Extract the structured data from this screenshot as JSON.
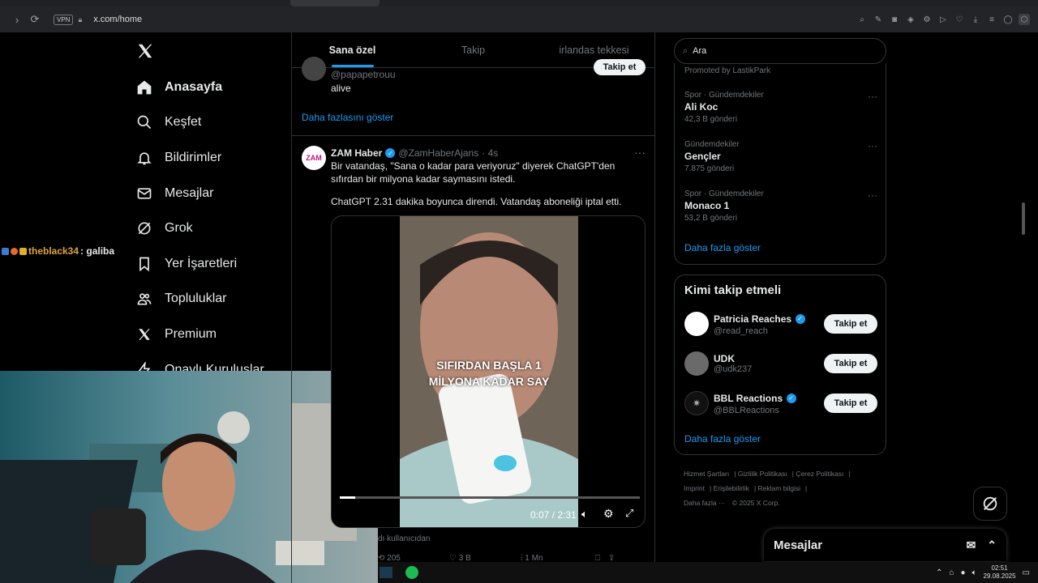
{
  "browser": {
    "url": "x.com/home",
    "vpn_label": "VPN"
  },
  "nav": {
    "items": [
      {
        "label": "Anasayfa",
        "icon": "home-icon"
      },
      {
        "label": "Keşfet",
        "icon": "search-icon"
      },
      {
        "label": "Bildirimler",
        "icon": "bell-icon"
      },
      {
        "label": "Mesajlar",
        "icon": "mail-icon"
      },
      {
        "label": "Grok",
        "icon": "grok-icon"
      },
      {
        "label": "Yer İşaretleri",
        "icon": "bookmark-icon"
      },
      {
        "label": "Topluluklar",
        "icon": "people-icon"
      },
      {
        "label": "Premium",
        "icon": "x-logo-icon"
      },
      {
        "label": "Onaylı Kuruluşlar",
        "icon": "lightning-icon"
      }
    ]
  },
  "chat": {
    "user": "theblack34",
    "message": ": galiba"
  },
  "timeline": {
    "tabs": [
      "Sana özel",
      "Takip",
      "irlandas tekkesi"
    ],
    "prev_tweet": {
      "handle": "@papapetrouu",
      "text": "alive",
      "follow_label": "Takip et"
    },
    "show_more": "Daha fazlasını göster",
    "tweet": {
      "name": "ZAM Haber",
      "avatar_text": "ZAM",
      "handle": "@ZamHaberAjans",
      "time": "· 4s",
      "text1": "Bir vatandaş, \"Sana o kadar para veriyoruz\" diyerek ChatGPT'den sıfırdan bir milyona kadar saymasını istedi.",
      "text2": "ChatGPT 2.31 dakika boyunca direndi. Vatandaş aboneliği iptal etti.",
      "video_caption_line1": "SIFIRDAN BAŞLA 1",
      "video_caption_line2": "MİLYONA KADAR SAY",
      "video_time": "0:07 / 2:31",
      "progress": 0.05,
      "source_text": "dı kullanıcıdan",
      "retweets": "205",
      "likes": "3 B",
      "views": "1 Mn"
    }
  },
  "right": {
    "search_placeholder": "Ara",
    "promoted": "Promoted by LastikPark",
    "trends": [
      {
        "category": "Spor · Gündemdekiler",
        "name": "Ali Koc",
        "count": "42,3 B gönderi"
      },
      {
        "category": "Gündemdekiler",
        "name": "Gençler",
        "count": "7.875 gönderi"
      },
      {
        "category": "Spor · Gündemdekiler",
        "name": "Monaco 1",
        "count": "53,2 B gönderi"
      }
    ],
    "trends_more": "Daha fazla göster",
    "who_title": "Kimi takip etmeli",
    "who": [
      {
        "name": "Patricia Reaches",
        "handle": "@read_reach",
        "verified": true,
        "button": "Takip et"
      },
      {
        "name": "UDK",
        "handle": "@udk237",
        "verified": false,
        "button": "Takip et"
      },
      {
        "name": "BBL Reactions",
        "handle": "@BBLReactions",
        "verified": true,
        "button": "Takip et"
      }
    ],
    "who_more": "Daha fazla göster",
    "footer": [
      "Hizmet Şartları",
      "Gizlilik Politikası",
      "Çerez Politikası",
      "Imprint",
      "Erişilebilirlik",
      "Reklam bilgisi",
      "Daha fazla ···",
      "© 2025 X Corp."
    ]
  },
  "messages_bar": {
    "title": "Mesajlar"
  },
  "taskbar": {
    "time": "02:51",
    "date": "29.08.2025"
  }
}
